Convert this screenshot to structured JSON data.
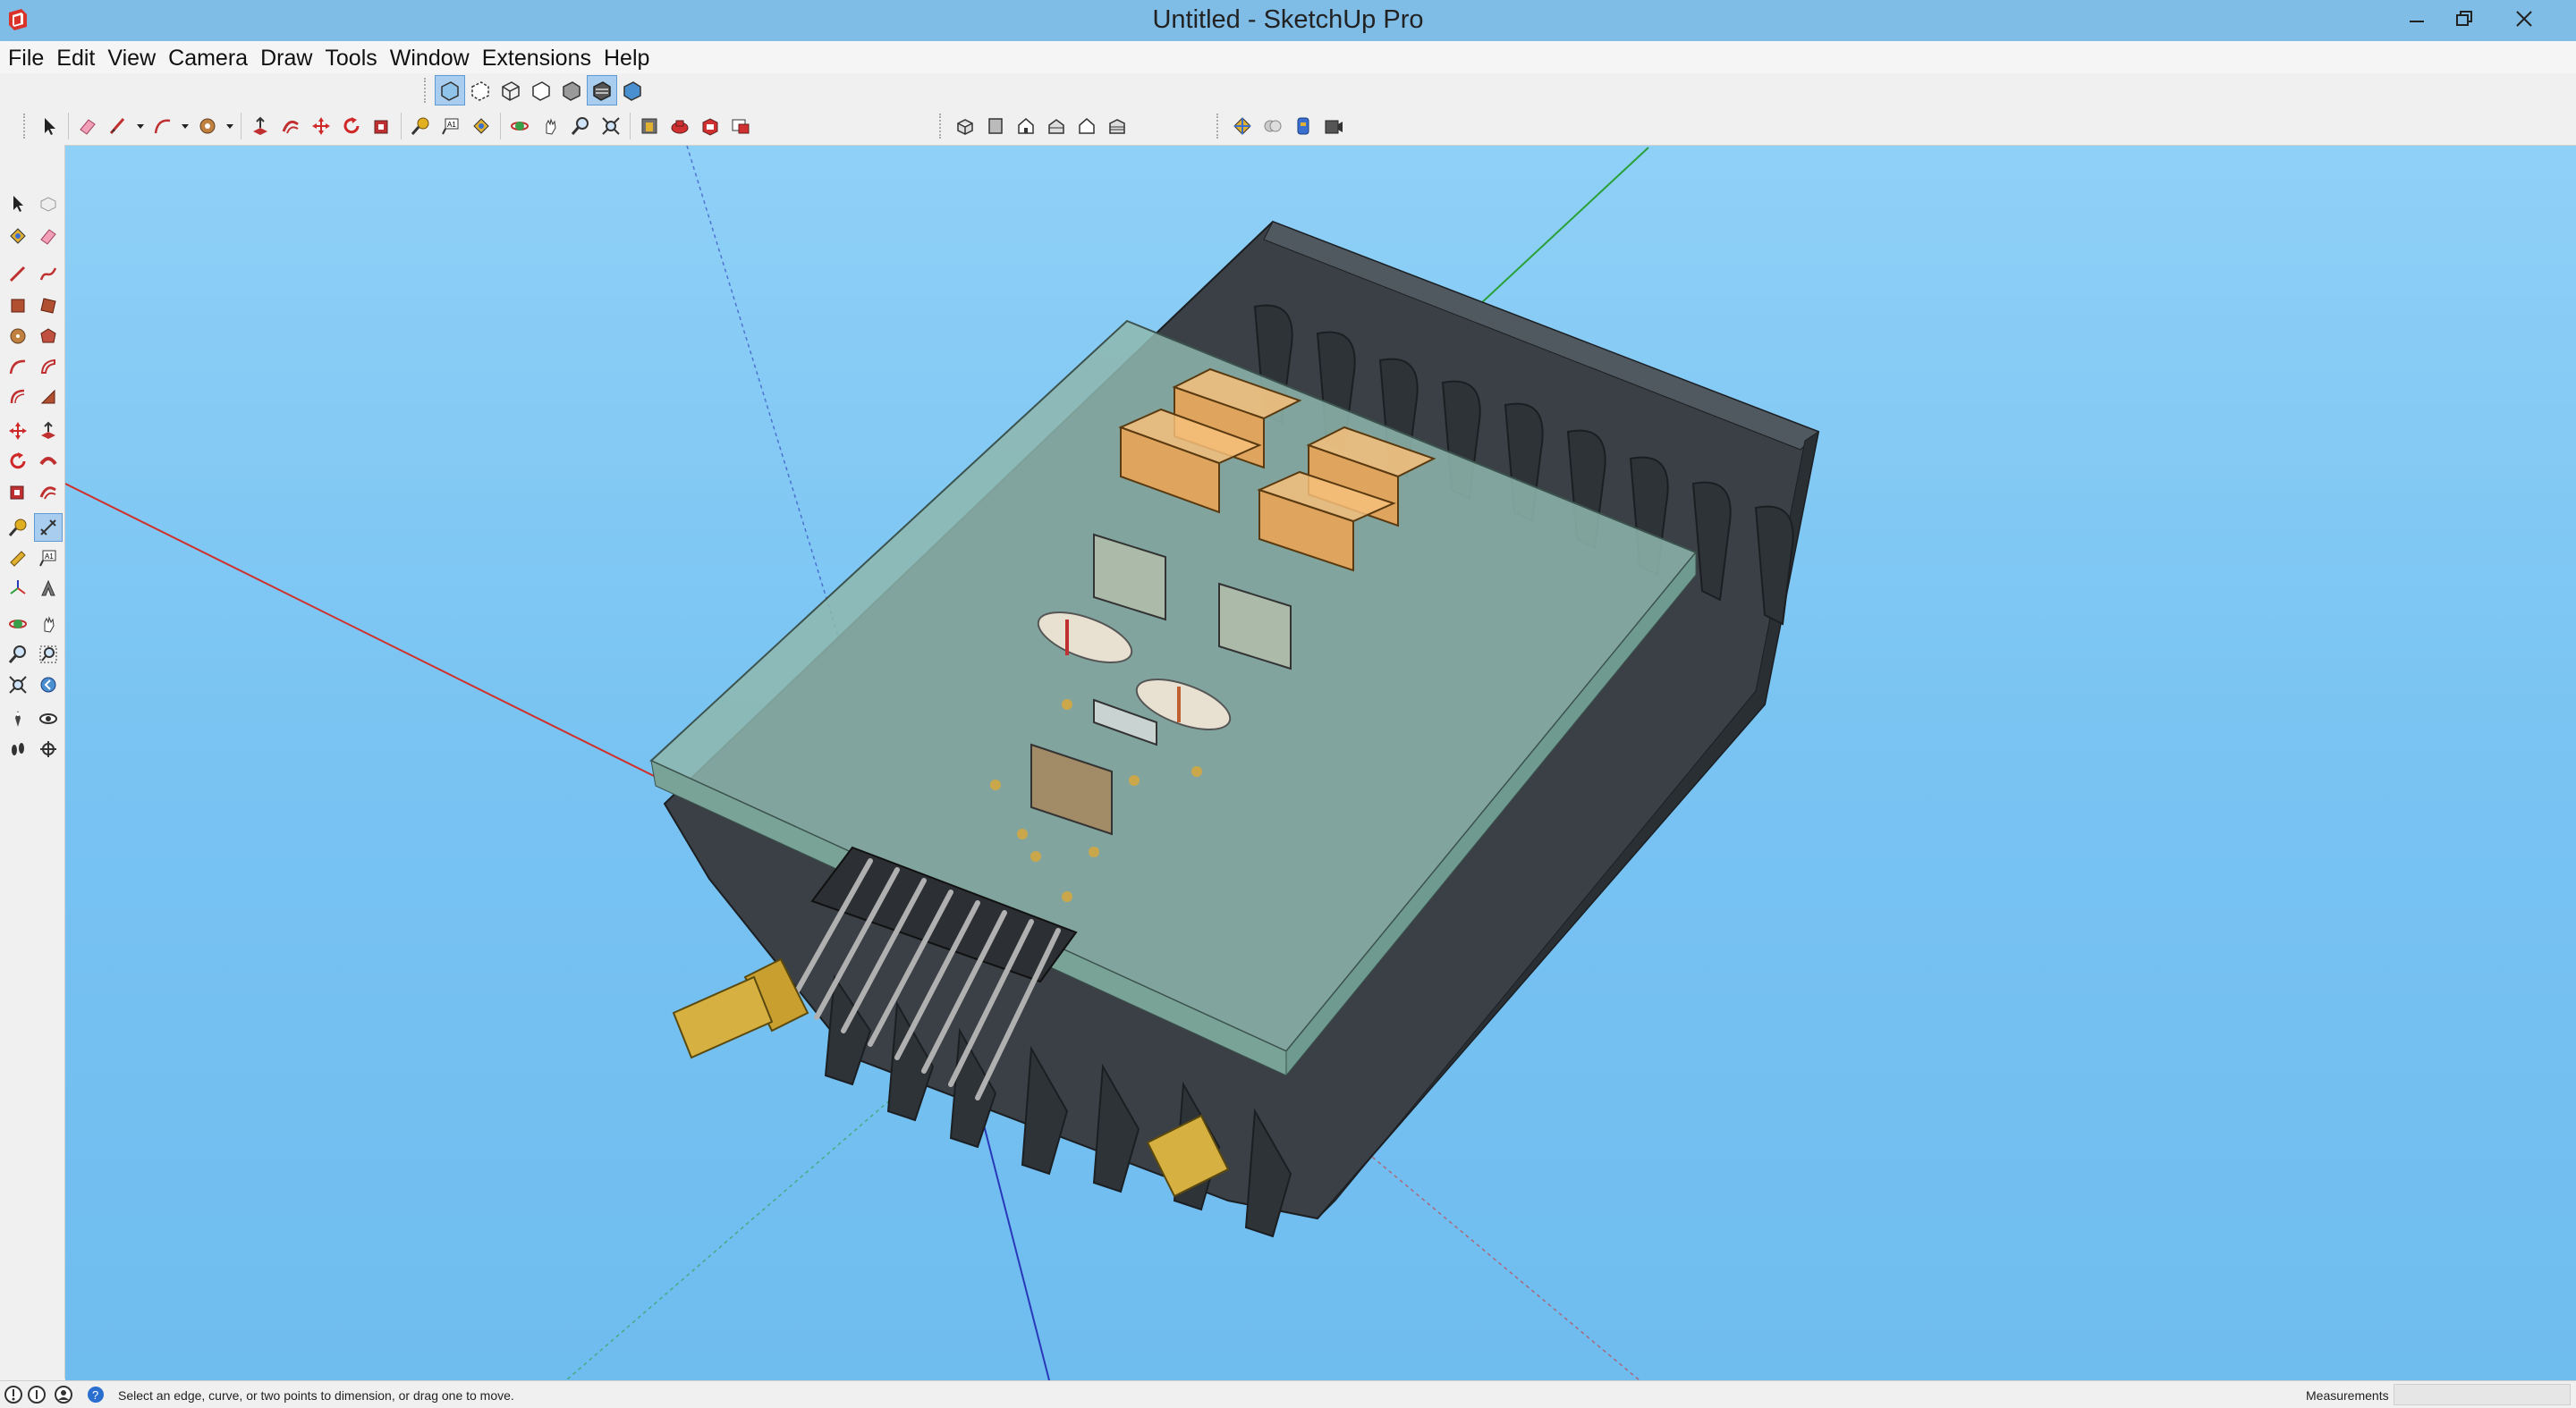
{
  "window": {
    "title": "Untitled - SketchUp Pro",
    "app_icon": "sketchup-logo-icon",
    "controls": [
      "minimize-icon",
      "restore-icon",
      "close-icon"
    ]
  },
  "menu": {
    "items": [
      "File",
      "Edit",
      "View",
      "Camera",
      "Draw",
      "Tools",
      "Window",
      "Extensions",
      "Help"
    ]
  },
  "toolbar_top": {
    "styles": [
      "xray-icon",
      "back-edges-icon",
      "wireframe-icon",
      "hidden-line-icon",
      "shaded-icon",
      "shaded-textures-icon",
      "monochrome-icon"
    ],
    "getting_started": [
      "select-icon",
      "eraser-icon",
      "line-icon",
      "arc-icon",
      "shapes-icon",
      "push-pull-icon",
      "offset-icon",
      "move-icon",
      "rotate-icon",
      "scale-icon",
      "tape-measure-icon",
      "text-icon",
      "paint-bucket-icon",
      "orbit-icon",
      "pan-icon",
      "zoom-icon",
      "zoom-extents-icon",
      "warehouse-icon",
      "extension-warehouse-icon",
      "layout-icon",
      "send-to-layout-icon"
    ],
    "views": [
      "iso-view-icon",
      "top-view-icon",
      "front-view-icon",
      "right-view-icon",
      "back-view-icon",
      "left-view-icon"
    ],
    "extras": [
      "component-icon",
      "dynamic-icon",
      "texture-icon",
      "camera-icon"
    ]
  },
  "toolbar_left": {
    "rows": [
      [
        "select-icon",
        "component-icon"
      ],
      [
        "paint-bucket-icon",
        "eraser-icon"
      ],
      [
        "line-icon",
        "freehand-icon"
      ],
      [
        "rectangle-icon",
        "rotated-rectangle-icon"
      ],
      [
        "circle-icon",
        "polygon-icon"
      ],
      [
        "arc-icon",
        "pie-icon"
      ],
      [
        "two-point-arc-icon",
        "three-point-arc-icon"
      ],
      [
        "move-icon",
        "push-pull-icon"
      ],
      [
        "rotate-icon",
        "follow-me-icon"
      ],
      [
        "scale-icon",
        "offset-icon"
      ],
      [
        "tape-measure-icon",
        "dimension-icon"
      ],
      [
        "protractor-icon",
        "text-icon"
      ],
      [
        "axes-icon",
        "3d-text-icon"
      ],
      [
        "orbit-icon",
        "pan-icon"
      ],
      [
        "zoom-icon",
        "zoom-window-icon"
      ],
      [
        "zoom-extents-icon",
        "previous-view-icon"
      ],
      [
        "position-camera-icon",
        "look-around-icon"
      ],
      [
        "walk-icon",
        "section-plane-icon"
      ]
    ]
  },
  "status": {
    "hint": "Select an edge, curve, or two points to dimension, or drag one to move.",
    "measurements_label": "Measurements",
    "measurements_value": "",
    "icons": [
      "geo-location-icon",
      "credits-icon",
      "user-icon",
      "instructor-icon"
    ]
  },
  "colors": {
    "titlebar": "#7fbde6",
    "viewport_sky": "#8fd0f7",
    "enclosure": "#3a4046",
    "pcb_glass": "#8eb7ae",
    "relay": "#f0a452",
    "axis_red": "#d0302a",
    "axis_green": "#2aa038",
    "axis_blue": "#2838b8"
  }
}
